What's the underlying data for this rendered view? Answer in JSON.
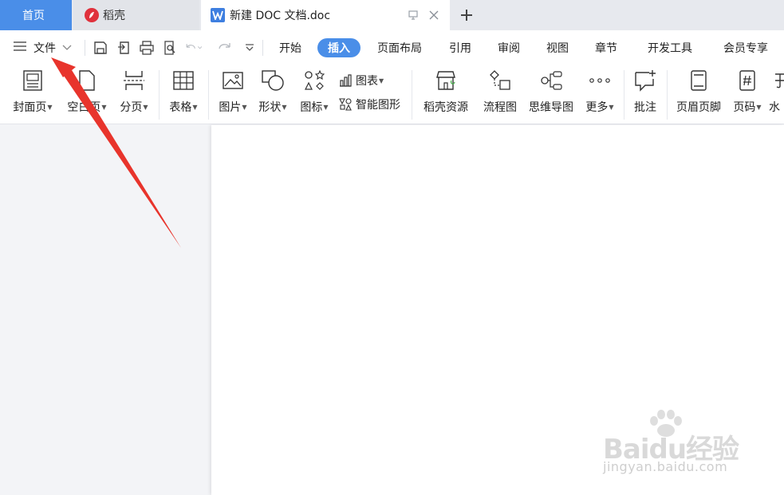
{
  "tabs": {
    "home": "首页",
    "daoke": "稻壳",
    "document": "新建 DOC 文档.doc"
  },
  "menubar": {
    "file_label": "文件",
    "items": [
      "开始",
      "插入",
      "页面布局",
      "引用",
      "审阅",
      "视图",
      "章节",
      "开发工具",
      "会员专享"
    ],
    "active": "插入"
  },
  "ribbon": {
    "cover_page": "封面页",
    "blank_page": "空白页",
    "page_break": "分页",
    "table": "表格",
    "picture": "图片",
    "shape": "形状",
    "icon": "图标",
    "chart": "图表",
    "smart_art": "智能图形",
    "daoke_resources": "稻壳资源",
    "flowchart": "流程图",
    "mind_map": "思维导图",
    "more": "更多",
    "comment": "批注",
    "header_footer": "页眉页脚",
    "page_number": "页码",
    "watermark_cut": "水"
  },
  "colors": {
    "accent": "#4a8ee8",
    "arrow": "#e8342c",
    "daoke_brand": "#e0313c"
  },
  "watermark": {
    "main": "Baidu经验",
    "sub": "jingyan.baidu.com"
  }
}
